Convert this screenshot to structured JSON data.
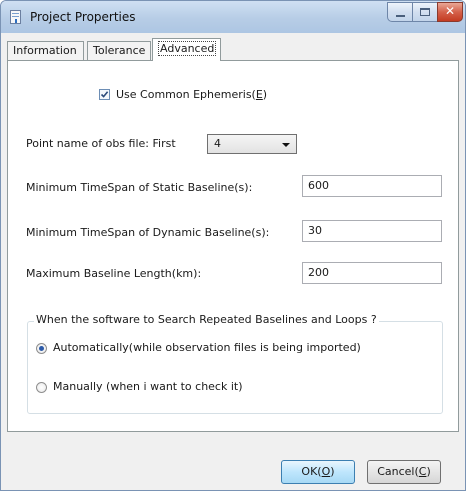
{
  "window": {
    "title": "Project Properties"
  },
  "tabs": [
    {
      "label": "Information",
      "selected": false
    },
    {
      "label": "Tolerance",
      "selected": false
    },
    {
      "label": "Advanced",
      "selected": true
    }
  ],
  "advanced": {
    "ephemeris": {
      "label_pre": "Use Common Ephemeris(",
      "mnemonic": "E",
      "label_post": ")",
      "checked": true
    },
    "point_name": {
      "label": "Point name of obs file: First",
      "selected": "4"
    },
    "static_span": {
      "label": "Minimum TimeSpan of Static Baseline(s):",
      "value": "600"
    },
    "dynamic_span": {
      "label": "Minimum TimeSpan of Dynamic Baseline(s):",
      "value": "30"
    },
    "max_length": {
      "label": "Maximum Baseline Length(km):",
      "value": "200"
    },
    "search_group": {
      "caption": "When the software to Search Repeated Baselines and Loops ?",
      "options": [
        {
          "label": "Automatically(while observation files is being imported)",
          "selected": true
        },
        {
          "label": "Manually (when i want to check it)",
          "selected": false
        }
      ]
    }
  },
  "buttons": {
    "ok": {
      "pre": "OK(",
      "mnemonic": "O",
      "post": ")"
    },
    "cancel": {
      "pre": "Cancel(",
      "mnemonic": "C",
      "post": ")"
    }
  },
  "icons": {
    "app": "document-properties-icon",
    "checkbox_check": "checkmark-icon",
    "combo": "chevron-down-icon"
  }
}
